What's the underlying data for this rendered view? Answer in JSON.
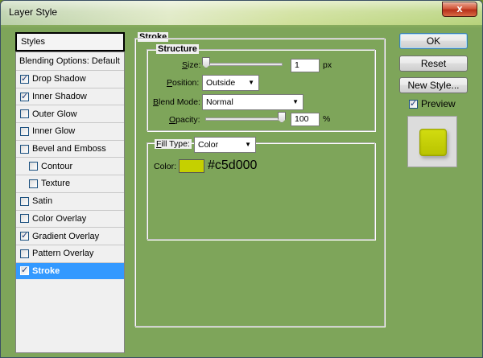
{
  "window": {
    "title": "Layer Style",
    "close_glyph": "x"
  },
  "styles_panel": {
    "header": "Styles",
    "blending": "Blending Options: Default",
    "items": [
      {
        "label": "Drop Shadow",
        "checked": true,
        "indent": false,
        "selected": false
      },
      {
        "label": "Inner Shadow",
        "checked": true,
        "indent": false,
        "selected": false
      },
      {
        "label": "Outer Glow",
        "checked": false,
        "indent": false,
        "selected": false
      },
      {
        "label": "Inner Glow",
        "checked": false,
        "indent": false,
        "selected": false
      },
      {
        "label": "Bevel and Emboss",
        "checked": false,
        "indent": false,
        "selected": false
      },
      {
        "label": "Contour",
        "checked": false,
        "indent": true,
        "selected": false
      },
      {
        "label": "Texture",
        "checked": false,
        "indent": true,
        "selected": false
      },
      {
        "label": "Satin",
        "checked": false,
        "indent": false,
        "selected": false
      },
      {
        "label": "Color Overlay",
        "checked": false,
        "indent": false,
        "selected": false
      },
      {
        "label": "Gradient Overlay",
        "checked": true,
        "indent": false,
        "selected": false
      },
      {
        "label": "Pattern Overlay",
        "checked": false,
        "indent": false,
        "selected": false
      },
      {
        "label": "Stroke",
        "checked": true,
        "indent": false,
        "selected": true
      }
    ]
  },
  "stroke": {
    "title": "Stroke",
    "structure_title": "Structure",
    "size": {
      "label": "Size:",
      "value": "1",
      "unit": "px"
    },
    "position": {
      "label": "Position:",
      "value": "Outside"
    },
    "blend_mode": {
      "label": "Blend Mode:",
      "value": "Normal"
    },
    "opacity": {
      "label": "Opacity:",
      "value": "100",
      "unit": "%"
    },
    "fill_type": {
      "label": "Fill Type:",
      "value": "Color"
    },
    "color": {
      "label": "Color:",
      "hex_text": "#c5d000",
      "swatch": "#c5d000"
    }
  },
  "buttons": {
    "ok": "OK",
    "reset": "Reset",
    "new_style": "New Style...",
    "preview_label": "Preview",
    "preview_checked": true
  },
  "colors": {
    "selection": "#3399ff",
    "stroke_color": "#c5d000"
  }
}
